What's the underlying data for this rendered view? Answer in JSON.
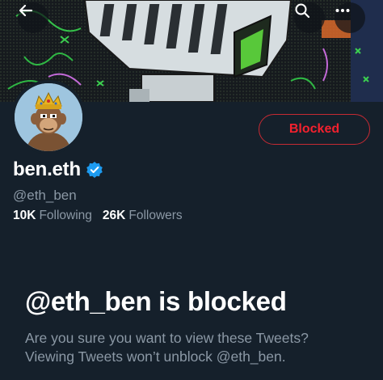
{
  "header": {
    "back_icon": "arrow-left-icon",
    "search_icon": "search-icon",
    "more_icon": "more-horizontal-icon"
  },
  "profile": {
    "display_name": "ben.eth",
    "handle": "@eth_ben",
    "verified": true,
    "verified_color": "#1d9bf0",
    "action_button_label": "Blocked",
    "action_button_color": "#f4212e",
    "following_count": "10K",
    "following_label": "Following",
    "followers_count": "26K",
    "followers_label": "Followers"
  },
  "blocked_notice": {
    "title": "@eth_ben is blocked",
    "line1": "Are you sure you want to view these Tweets?",
    "line2": "Viewing Tweets won’t unblock @eth_ben."
  },
  "colors": {
    "background": "#15202b",
    "secondary_text": "#8b98a5"
  }
}
